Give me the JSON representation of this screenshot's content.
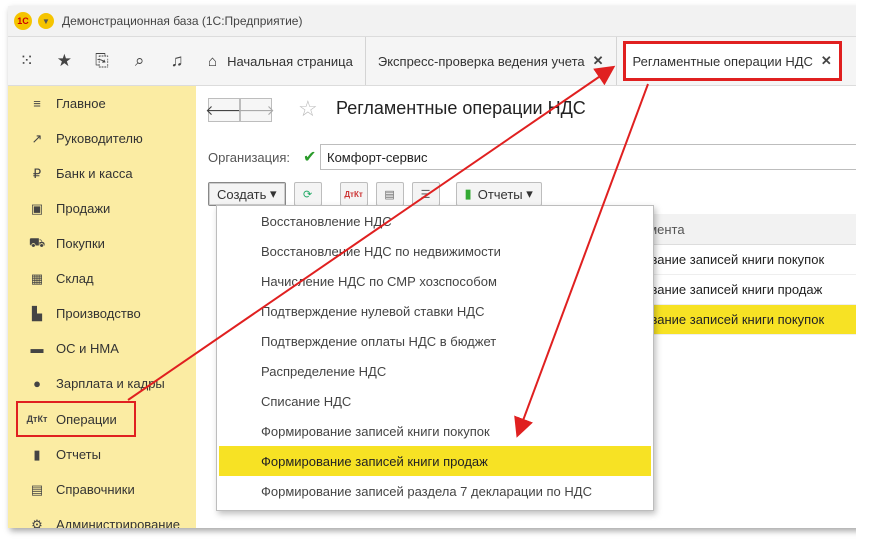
{
  "window": {
    "title": "Демонстрационная база  (1С:Предприятие)",
    "logo": "1С"
  },
  "toolbar": {
    "icons": [
      "apps-grid-icon",
      "star-icon",
      "history-icon",
      "search-icon",
      "bell-icon"
    ]
  },
  "tabs": [
    {
      "label": "Начальная страница"
    },
    {
      "label": "Экспресс-проверка ведения учета"
    },
    {
      "label": "Регламентные операции НДС"
    }
  ],
  "sidebar": {
    "items": [
      {
        "label": "Главное",
        "icon": "≡"
      },
      {
        "label": "Руководителю",
        "icon": "↗"
      },
      {
        "label": "Банк и касса",
        "icon": "₽"
      },
      {
        "label": "Продажи",
        "icon": "▣"
      },
      {
        "label": "Покупки",
        "icon": "⛟"
      },
      {
        "label": "Склад",
        "icon": "▦"
      },
      {
        "label": "Производство",
        "icon": "▙"
      },
      {
        "label": "ОС и НМА",
        "icon": "▬"
      },
      {
        "label": "Зарплата и кадры",
        "icon": "●"
      },
      {
        "label": "Операции",
        "icon": "ДтКт"
      },
      {
        "label": "Отчеты",
        "icon": "▮"
      },
      {
        "label": "Справочники",
        "icon": "▤"
      },
      {
        "label": "Администрирование",
        "icon": "⚙"
      }
    ]
  },
  "form": {
    "title": "Регламентные операции НДС",
    "org_label": "Организация:",
    "org_value": "Комфорт-сервис",
    "create_label": "Создать",
    "reports_label": "Отчеты",
    "dtkt_label": "ДтКт"
  },
  "grid": {
    "header": "кумента",
    "rows": [
      {
        "text": "рование записей книги покупок",
        "selected": false
      },
      {
        "text": "рование записей книги продаж",
        "selected": false
      },
      {
        "text": "рование записей книги покупок",
        "selected": true
      }
    ]
  },
  "create_menu": {
    "items": [
      "Восстановление НДС",
      "Восстановление НДС по недвижимости",
      "Начисление НДС по СМР хозспособом",
      "Подтверждение нулевой ставки НДС",
      "Подтверждение оплаты НДС в бюджет",
      "Распределение НДС",
      "Списание НДС",
      "Формирование записей книги покупок",
      "Формирование записей книги продаж",
      "Формирование записей раздела 7 декларации по НДС"
    ],
    "highlighted_index": 8
  },
  "colors": {
    "sidebar": "#fbeca3",
    "highlight": "#f7e224",
    "annotation": "#e02020"
  }
}
